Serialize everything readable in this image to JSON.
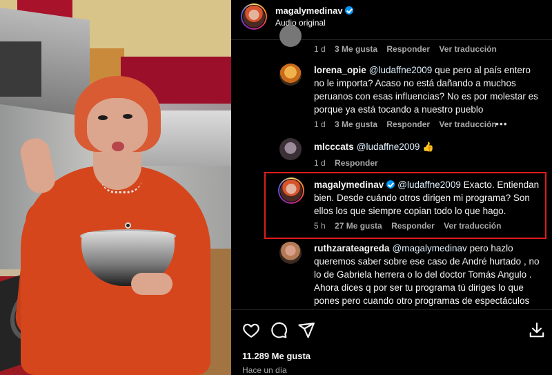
{
  "post": {
    "author": "magalymedinav",
    "audio": "Audio original",
    "likes": "11.289 Me gusta",
    "date": "Hace un día"
  },
  "comments": [
    {
      "username": "",
      "text": "",
      "time": "1 d",
      "likes": "3 Me gusta",
      "reply": "Responder",
      "translate": "Ver traducción"
    },
    {
      "username": "lorena_opie",
      "mention": "@ludaffne2009",
      "text": " que pero al país entero no le importa? Acaso no está dañando a muchos peruanos con esas influencias? No es por molestar es porque ya está tocando a nuestro pueblo",
      "time": "1 d",
      "likes": "3 Me gusta",
      "reply": "Responder",
      "translate": "Ver traducción",
      "more": "•••"
    },
    {
      "username": "mlcccats",
      "mention": "@ludaffne2009",
      "text": " 👍",
      "time": "1 d",
      "reply": "Responder"
    },
    {
      "username": "magalymedinav",
      "mention": "@ludaffne2009",
      "text": " Exacto. Entiendan bien. Desde cuándo otros dirigen mi programa? Son ellos los que siempre copian todo lo que hago.",
      "time": "5 h",
      "likes": "27 Me gusta",
      "reply": "Responder",
      "translate": "Ver traducción"
    },
    {
      "username": "ruthzarateagreda",
      "mention": "@magalymedinav",
      "text": " pero hazlo queremos saber sobre ese caso de André hurtado , no lo de Gabriela herrera o lo del doctor Tomás Angulo . Ahora dices q por ser tu programa tú diriges lo que pones pero cuando otro programas de espectáculos hacían eso los chancabas porfavor Magaly que"
    }
  ],
  "icons": [
    "heart-icon",
    "comment-icon",
    "share-icon",
    "download-icon",
    "verified-icon"
  ],
  "colors": {
    "background": "#000000",
    "verified": "#0095f6",
    "highlight": "#e01b1b",
    "meta": "#a8a8a8"
  }
}
